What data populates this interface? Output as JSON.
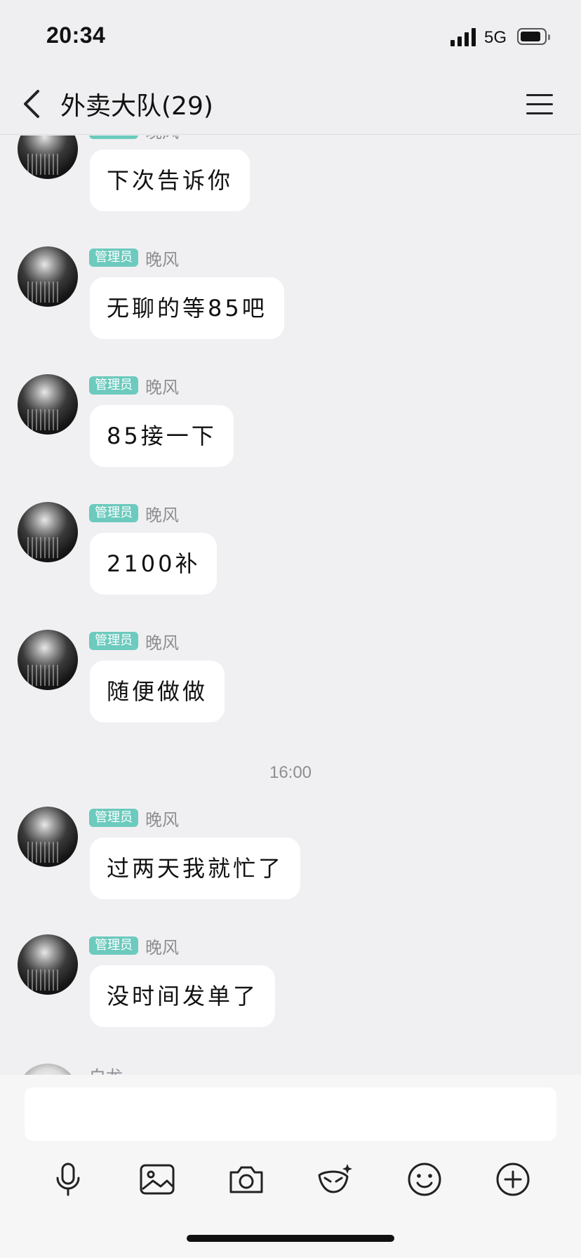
{
  "status_bar": {
    "time": "20:34",
    "network": "5G"
  },
  "nav": {
    "title": "外卖大队(29)"
  },
  "messages": [
    {
      "role": "管理员",
      "sender": "晚风",
      "text": "下次告诉你"
    },
    {
      "role": "管理员",
      "sender": "晚风",
      "text": "无聊的等85吧"
    },
    {
      "role": "管理员",
      "sender": "晚风",
      "text": "85接一下"
    },
    {
      "role": "管理员",
      "sender": "晚风",
      "text": "2100补"
    },
    {
      "role": "管理员",
      "sender": "晚风",
      "text": "随便做做"
    },
    {
      "role": "管理员",
      "sender": "晚风",
      "text": "过两天我就忙了"
    },
    {
      "role": "管理员",
      "sender": "晚风",
      "text": "没时间发单了"
    }
  ],
  "timestamp": "16:00",
  "partial_next_sender": "白龙",
  "input": {
    "value": ""
  },
  "toolbar_icons": [
    "microphone-icon",
    "image-icon",
    "camera-icon",
    "fx-mask-icon",
    "emoji-icon",
    "plus-icon"
  ]
}
